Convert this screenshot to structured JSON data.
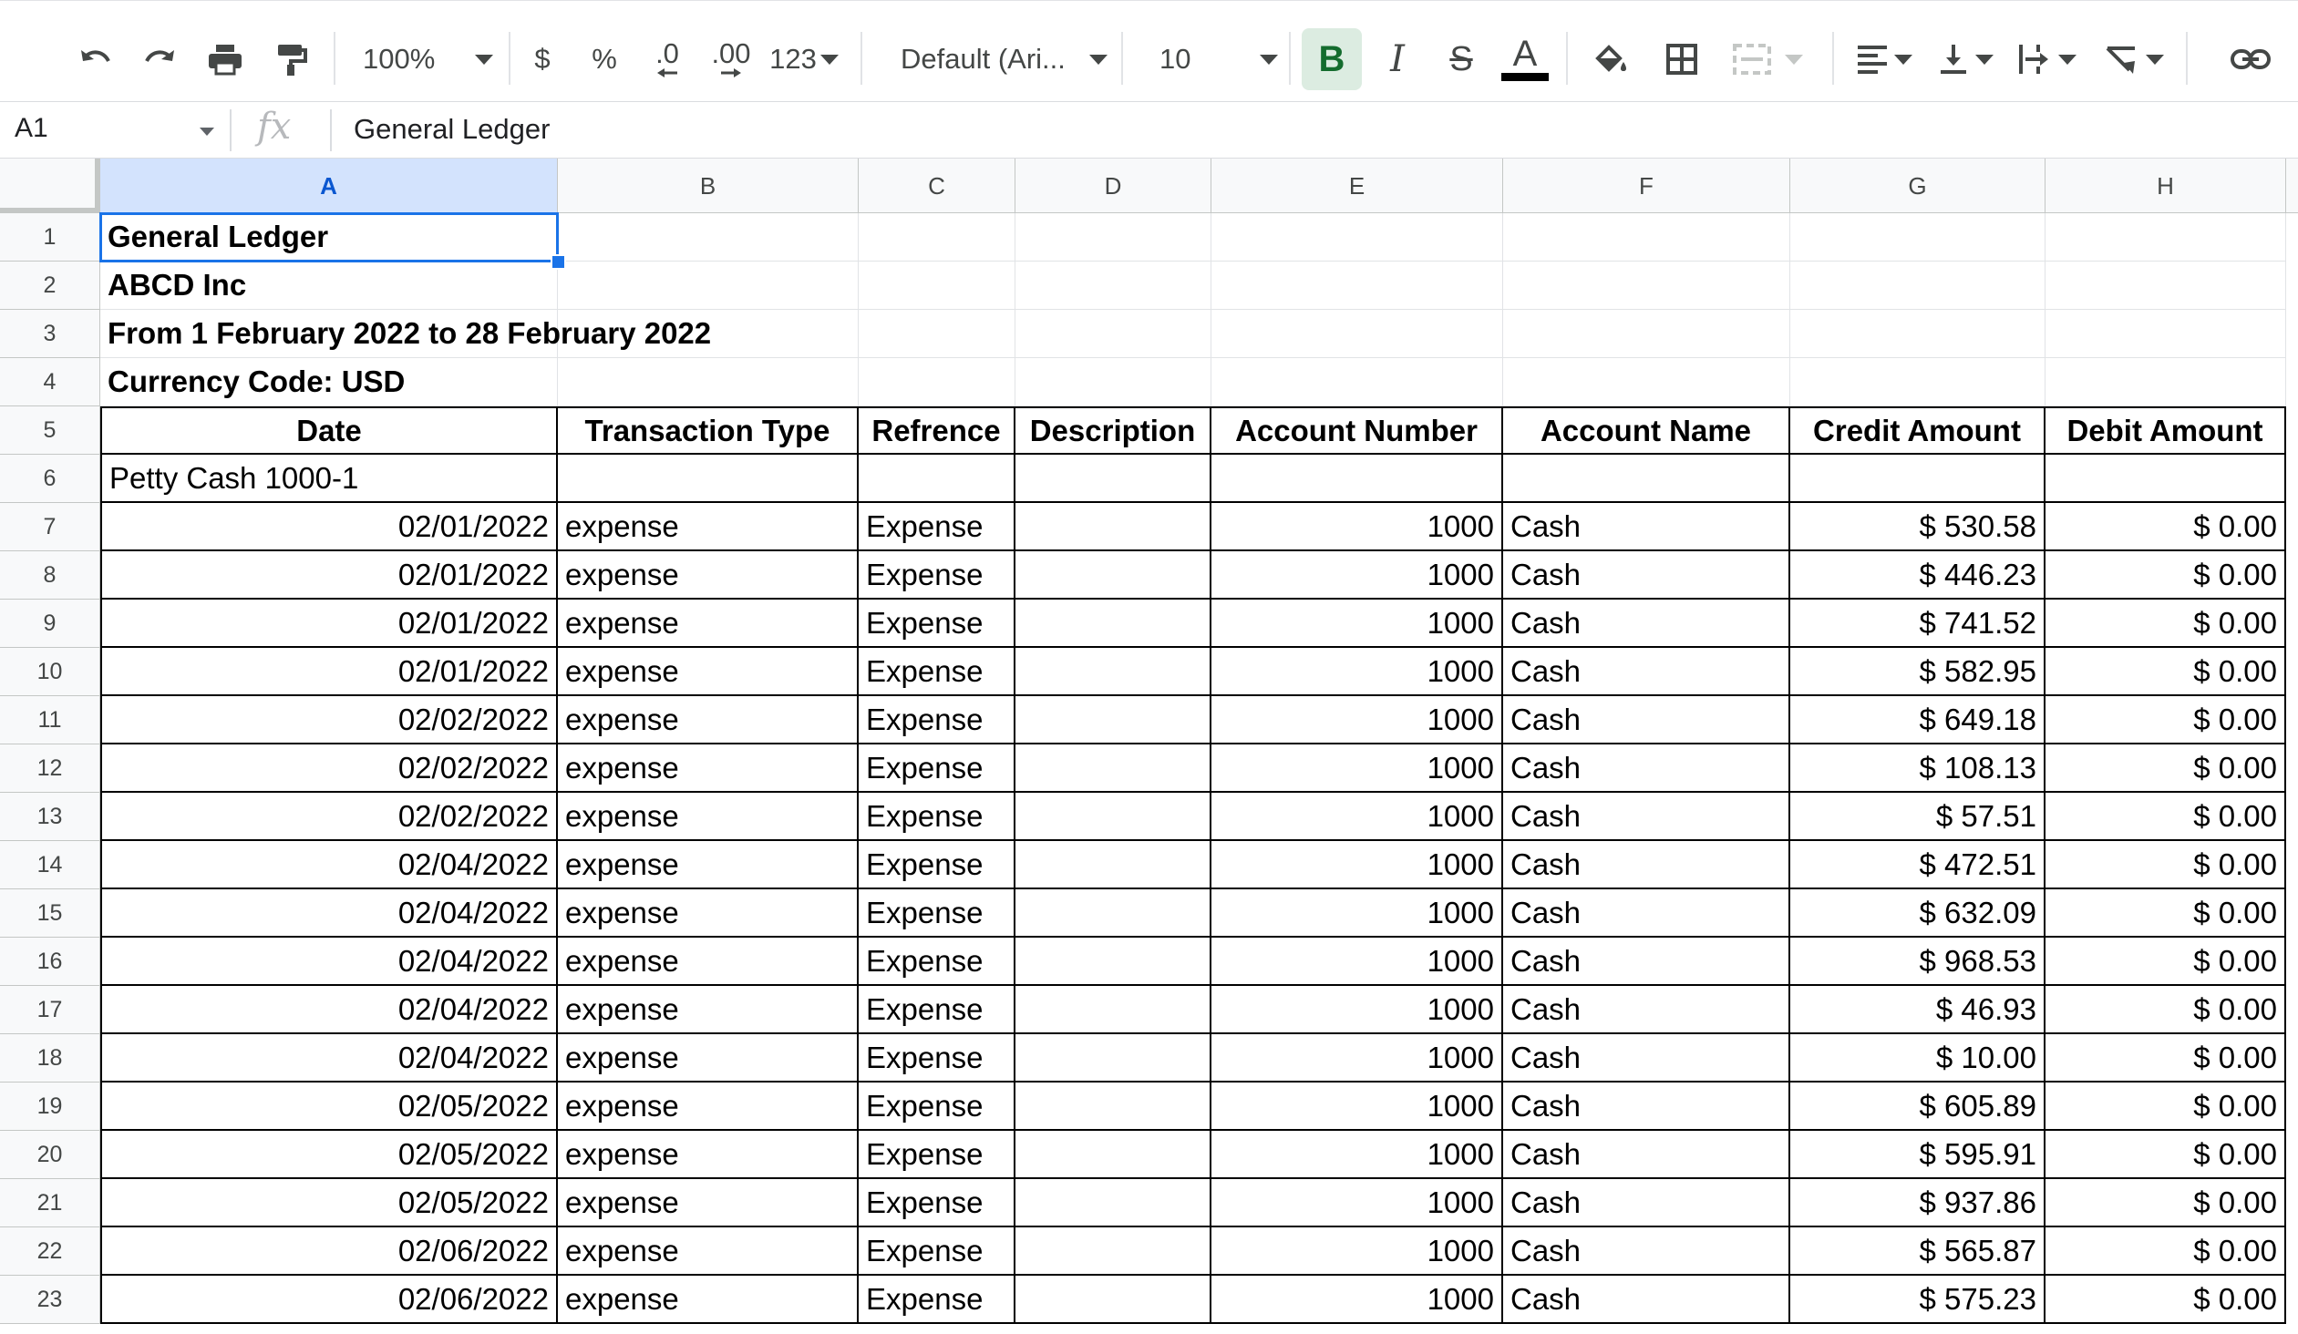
{
  "toolbar": {
    "zoom": "100%",
    "currency": "$",
    "percent": "%",
    "dec_decrease": ".0",
    "dec_increase": ".00",
    "more_formats": "123",
    "font": "Default (Ari...",
    "font_size": "10",
    "bold": "B",
    "italic": "I",
    "strike": "S",
    "text_color_letter": "A",
    "text_color": "#000000"
  },
  "formula_bar": {
    "name_box": "A1",
    "fx": "fx",
    "content": "General Ledger"
  },
  "columns": [
    "A",
    "B",
    "C",
    "D",
    "E",
    "F",
    "G",
    "H"
  ],
  "selected_column": "A",
  "rows": [
    {
      "n": "1",
      "cells": [
        "General Ledger",
        "",
        "",
        "",
        "",
        "",
        "",
        ""
      ]
    },
    {
      "n": "2",
      "cells": [
        "ABCD Inc",
        "",
        "",
        "",
        "",
        "",
        "",
        ""
      ]
    },
    {
      "n": "3",
      "cells": [
        "From 1 February 2022  to 28 February 2022",
        "",
        "",
        "",
        "",
        "",
        "",
        ""
      ]
    },
    {
      "n": "4",
      "cells": [
        "Currency Code: USD",
        "",
        "",
        "",
        "",
        "",
        "",
        ""
      ]
    },
    {
      "n": "5",
      "cells": [
        "Date",
        "Transaction Type",
        "Refrence",
        "Description",
        "Account Number",
        "Account Name",
        "Credit Amount",
        "Debit Amount"
      ]
    },
    {
      "n": "6",
      "cells": [
        "Petty Cash 1000-1",
        "",
        "",
        "",
        "",
        "",
        "",
        ""
      ]
    },
    {
      "n": "7",
      "cells": [
        "02/01/2022",
        "expense",
        "Expense",
        "",
        "1000",
        "Cash",
        "$ 530.58",
        "$ 0.00"
      ]
    },
    {
      "n": "8",
      "cells": [
        "02/01/2022",
        "expense",
        "Expense",
        "",
        "1000",
        "Cash",
        "$ 446.23",
        "$ 0.00"
      ]
    },
    {
      "n": "9",
      "cells": [
        "02/01/2022",
        "expense",
        "Expense",
        "",
        "1000",
        "Cash",
        "$ 741.52",
        "$ 0.00"
      ]
    },
    {
      "n": "10",
      "cells": [
        "02/01/2022",
        "expense",
        "Expense",
        "",
        "1000",
        "Cash",
        "$ 582.95",
        "$ 0.00"
      ]
    },
    {
      "n": "11",
      "cells": [
        "02/02/2022",
        "expense",
        "Expense",
        "",
        "1000",
        "Cash",
        "$ 649.18",
        "$ 0.00"
      ]
    },
    {
      "n": "12",
      "cells": [
        "02/02/2022",
        "expense",
        "Expense",
        "",
        "1000",
        "Cash",
        "$ 108.13",
        "$ 0.00"
      ]
    },
    {
      "n": "13",
      "cells": [
        "02/02/2022",
        "expense",
        "Expense",
        "",
        "1000",
        "Cash",
        "$ 57.51",
        "$ 0.00"
      ]
    },
    {
      "n": "14",
      "cells": [
        "02/04/2022",
        "expense",
        "Expense",
        "",
        "1000",
        "Cash",
        "$ 472.51",
        "$ 0.00"
      ]
    },
    {
      "n": "15",
      "cells": [
        "02/04/2022",
        "expense",
        "Expense",
        "",
        "1000",
        "Cash",
        "$ 632.09",
        "$ 0.00"
      ]
    },
    {
      "n": "16",
      "cells": [
        "02/04/2022",
        "expense",
        "Expense",
        "",
        "1000",
        "Cash",
        "$ 968.53",
        "$ 0.00"
      ]
    },
    {
      "n": "17",
      "cells": [
        "02/04/2022",
        "expense",
        "Expense",
        "",
        "1000",
        "Cash",
        "$ 46.93",
        "$ 0.00"
      ]
    },
    {
      "n": "18",
      "cells": [
        "02/04/2022",
        "expense",
        "Expense",
        "",
        "1000",
        "Cash",
        "$ 10.00",
        "$ 0.00"
      ]
    },
    {
      "n": "19",
      "cells": [
        "02/05/2022",
        "expense",
        "Expense",
        "",
        "1000",
        "Cash",
        "$ 605.89",
        "$ 0.00"
      ]
    },
    {
      "n": "20",
      "cells": [
        "02/05/2022",
        "expense",
        "Expense",
        "",
        "1000",
        "Cash",
        "$ 595.91",
        "$ 0.00"
      ]
    },
    {
      "n": "21",
      "cells": [
        "02/05/2022",
        "expense",
        "Expense",
        "",
        "1000",
        "Cash",
        "$ 937.86",
        "$ 0.00"
      ]
    },
    {
      "n": "22",
      "cells": [
        "02/06/2022",
        "expense",
        "Expense",
        "",
        "1000",
        "Cash",
        "$ 565.87",
        "$ 0.00"
      ]
    },
    {
      "n": "23",
      "cells": [
        "02/06/2022",
        "expense",
        "Expense",
        "",
        "1000",
        "Cash",
        "$ 575.23",
        "$ 0.00"
      ]
    }
  ],
  "colors": {
    "selection": "#1a73e8",
    "bold_active_bg": "#dcece1",
    "bold_active_fg": "#146c2e"
  }
}
